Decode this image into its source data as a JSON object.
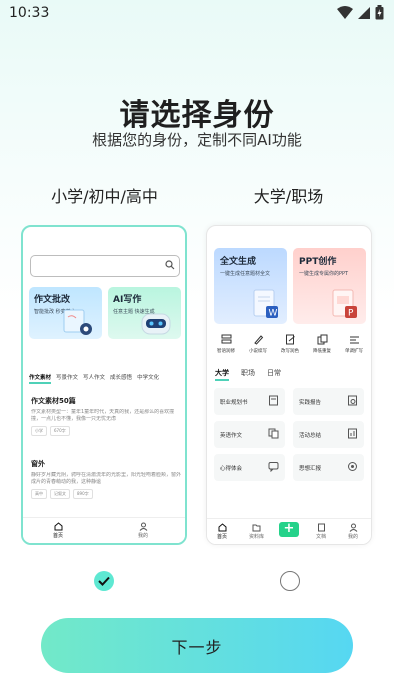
{
  "status_bar": {
    "time": "10:33"
  },
  "header": {
    "title": "请选择身份",
    "subtitle": "根据您的身份，定制不同AI功能"
  },
  "roles": [
    {
      "label": "小学/初中/高中",
      "selected": true
    },
    {
      "label": "大学/职场",
      "selected": false
    }
  ],
  "left_preview": {
    "features": [
      {
        "title": "作文批改",
        "sub": "智能批改 秒变美文"
      },
      {
        "title": "AI写作",
        "sub": "任意主题 快速生成"
      }
    ],
    "tabs": [
      "作文素材",
      "写景作文",
      "写人作文",
      "成长感悟",
      "中学文化"
    ],
    "articles": [
      {
        "title": "作文素材50篇",
        "text": "作文素材类型一：童年1童年时代，天真的我，还是那么的喜欢撞撞，一点儿也不懂，我像一只无忧无虑",
        "tags": [
          "小学",
          "670字"
        ]
      },
      {
        "title": "窗外",
        "text": "静好岁月藏光阴，骋呼在清澈流年的光影里，阳光轻吻着脸颊，窗外成片的青春萌动的我，这种静谧",
        "tags": [
          "高中",
          "记叙文",
          "890字"
        ]
      }
    ],
    "nav": [
      "首页",
      "我的"
    ]
  },
  "right_preview": {
    "features": [
      {
        "title": "全文生成",
        "sub": "一键生成任意题材全文"
      },
      {
        "title": "PPT创作",
        "sub": "一键生成专属你的PPT"
      }
    ],
    "tools": [
      "智语润修",
      "小说续写",
      "改写润色",
      "降低重复",
      "单调扩写"
    ],
    "segments": [
      "大学",
      "职场",
      "日常"
    ],
    "cells": [
      "职业规划书",
      "实践报告",
      "英语作文",
      "活动总结",
      "心得体会",
      "思想汇报"
    ],
    "nav": [
      "首页",
      "资料库",
      "文档",
      "我的"
    ]
  },
  "next_button": {
    "label": "下一步"
  },
  "colors": {
    "accent": "#5ee8d2",
    "button_start": "#72e9c8",
    "button_end": "#56d7f2"
  }
}
